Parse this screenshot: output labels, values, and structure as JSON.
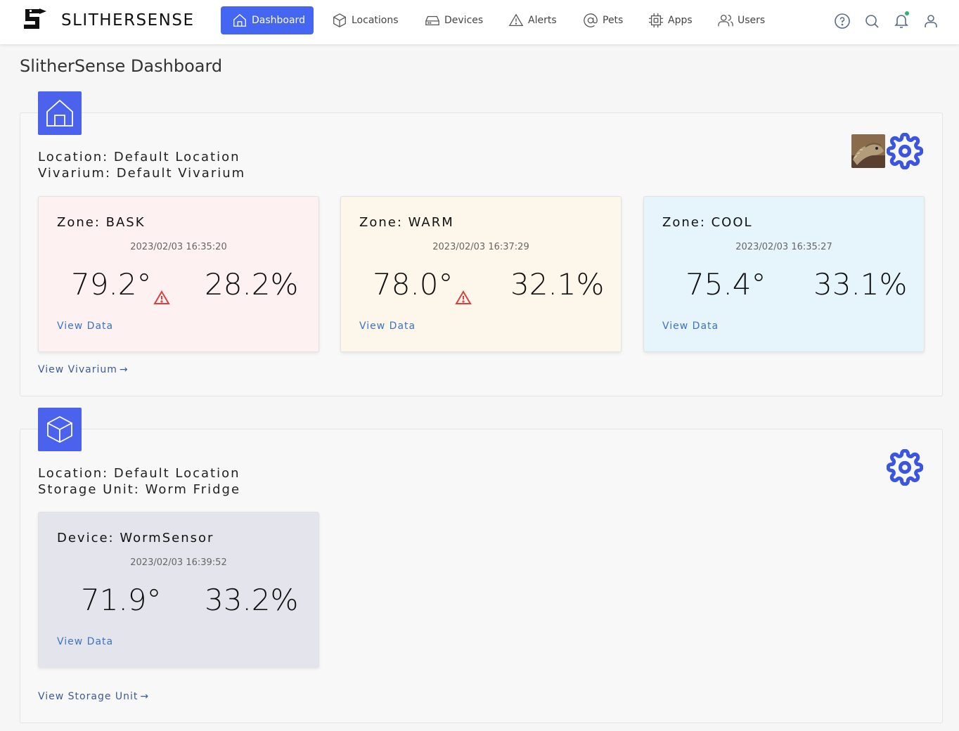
{
  "brand": {
    "name": "SLITHERSENSE"
  },
  "nav": {
    "items": [
      {
        "label": "Dashboard",
        "icon": "home-icon",
        "active": true
      },
      {
        "label": "Locations",
        "icon": "cube-icon"
      },
      {
        "label": "Devices",
        "icon": "hard-drive-icon"
      },
      {
        "label": "Alerts",
        "icon": "alert-triangle-icon"
      },
      {
        "label": "Pets",
        "icon": "at-sign-icon"
      },
      {
        "label": "Apps",
        "icon": "chip-icon"
      },
      {
        "label": "Users",
        "icon": "users-icon"
      }
    ]
  },
  "utility_icons": [
    "help-icon",
    "search-icon",
    "bell-icon",
    "user-icon"
  ],
  "page": {
    "title": "SlitherSense Dashboard"
  },
  "vivarium": {
    "location_line": "Location: Default Location",
    "unit_line": "Vivarium: Default Vivarium",
    "link": "View Vivarium",
    "zones": [
      {
        "title": "Zone: BASK",
        "time": "2023/02/03 16:35:20",
        "temp": "79.2°",
        "humidity": "28.2%",
        "alert": true,
        "link": "View Data",
        "bg": "#fdf2f1"
      },
      {
        "title": "Zone: WARM",
        "time": "2023/02/03 16:37:29",
        "temp": "78.0°",
        "humidity": "32.1%",
        "alert": true,
        "link": "View Data",
        "bg": "#fdf6ea"
      },
      {
        "title": "Zone: COOL",
        "time": "2023/02/03 16:35:27",
        "temp": "75.4°",
        "humidity": "33.1%",
        "alert": false,
        "link": "View Data",
        "bg": "#e6f4fb"
      }
    ]
  },
  "storage": {
    "location_line": "Location: Default Location",
    "unit_line": "Storage Unit: Worm Fridge",
    "link": "View Storage Unit",
    "devices": [
      {
        "title": "Device: WormSensor",
        "time": "2023/02/03 16:39:52",
        "temp": "71.9°",
        "humidity": "33.2%",
        "alert": false,
        "link": "View Data",
        "bg": "#e4e4ec"
      }
    ]
  },
  "colors": {
    "accent": "#4466f0",
    "alert": "#d94040",
    "link": "#3a73c8"
  }
}
